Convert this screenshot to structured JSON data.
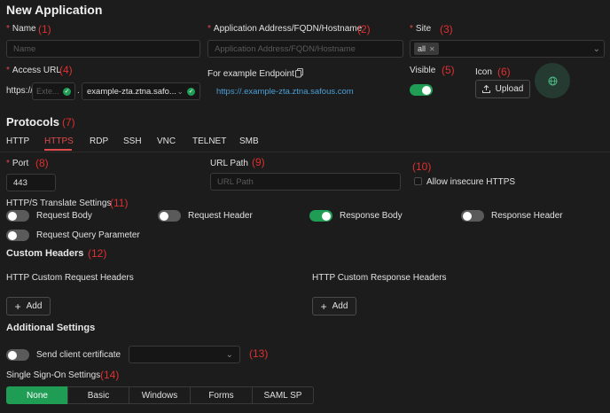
{
  "page": {
    "title": "New Application"
  },
  "colors": {
    "accent": "#1f9d55",
    "annotation": "#e03030",
    "link": "#4a9fd6",
    "tab_active": "#e04a4a"
  },
  "form": {
    "name": {
      "label": "Name",
      "placeholder": "Name",
      "annotation": "(1)"
    },
    "address": {
      "label": "Application Address/FQDN/Hostname",
      "placeholder": "Application Address/FQDN/Hostname",
      "annotation": "(2)"
    },
    "site": {
      "label": "Site",
      "tag": "all",
      "annotation": "(3)"
    },
    "access_url": {
      "label": "Access URL",
      "annotation": "(4)",
      "prefix": "https://",
      "subdomain_placeholder": "Exte...",
      "domain_value": "example-zta.ztna.safo...",
      "dot": "."
    },
    "example_endpoint": {
      "label": "For example Endpoint",
      "url": "https://.example-zta.ztna.safous.com"
    },
    "visible": {
      "label": "Visible",
      "annotation": "(5)",
      "enabled": true
    },
    "icon": {
      "label": "Icon",
      "annotation": "(6)",
      "upload_label": "Upload",
      "preview_icon": "globe-icon"
    }
  },
  "protocols": {
    "title": "Protocols",
    "annotation": "(7)",
    "tabs": [
      "HTTP",
      "HTTPS",
      "RDP",
      "SSH",
      "VNC",
      "TELNET",
      "SMB"
    ],
    "active_tab": "HTTPS",
    "port": {
      "label": "Port",
      "value": "443",
      "annotation": "(8)"
    },
    "url_path": {
      "label": "URL Path",
      "placeholder": "URL Path",
      "annotation": "(9)"
    },
    "insecure": {
      "label": "Allow insecure HTTPS",
      "annotation": "(10)",
      "checked": false
    }
  },
  "translate": {
    "title": "HTTP/S Translate Settings",
    "annotation": "(11)",
    "items": [
      {
        "label": "Request Body",
        "on": false
      },
      {
        "label": "Request Header",
        "on": false
      },
      {
        "label": "Response Body",
        "on": true
      },
      {
        "label": "Response Header",
        "on": false
      },
      {
        "label": "Request Query Parameter",
        "on": false
      }
    ]
  },
  "custom_headers": {
    "title": "Custom Headers",
    "annotation": "(12)",
    "request_label": "HTTP Custom Request Headers",
    "response_label": "HTTP Custom Response Headers",
    "add_label": "Add"
  },
  "additional": {
    "title": "Additional Settings",
    "client_cert_label": "Send client certificate",
    "client_cert_on": false,
    "annotation": "(13)"
  },
  "sso": {
    "title": "Single Sign-On Settings",
    "annotation": "(14)",
    "options": [
      "None",
      "Basic",
      "Windows",
      "Forms",
      "SAML SP"
    ],
    "active": "None"
  }
}
